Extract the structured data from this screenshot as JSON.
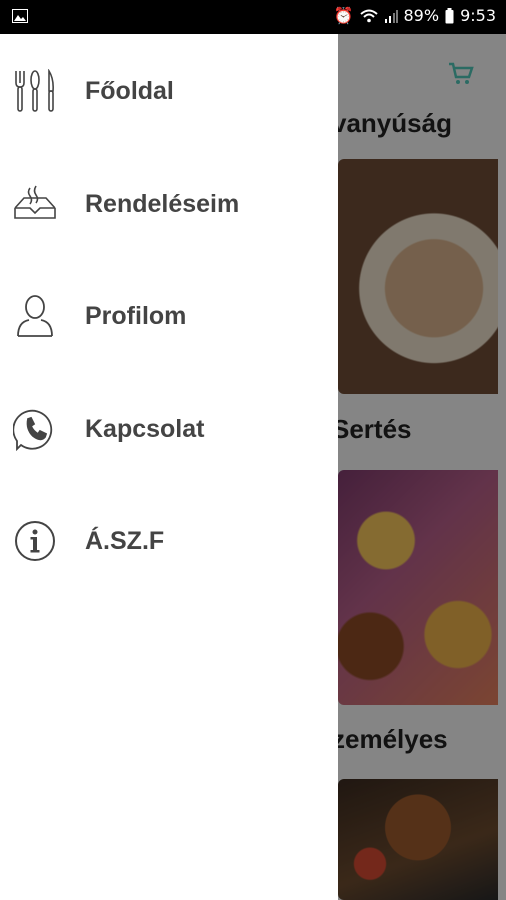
{
  "status_bar": {
    "battery": "89%",
    "time": "9:53"
  },
  "drawer": {
    "items": [
      {
        "label": "Főoldal",
        "icon": "cutlery-icon"
      },
      {
        "label": "Rendeléseim",
        "icon": "food-tray-icon"
      },
      {
        "label": "Profilom",
        "icon": "user-icon"
      },
      {
        "label": "Kapcsolat",
        "icon": "phone-icon"
      },
      {
        "label": "Á.SZ.F",
        "icon": "info-icon"
      }
    ]
  },
  "background": {
    "headings": [
      "vanyúság",
      "Sertés",
      "zemélyes"
    ],
    "accent_color": "#4fc3b5"
  }
}
